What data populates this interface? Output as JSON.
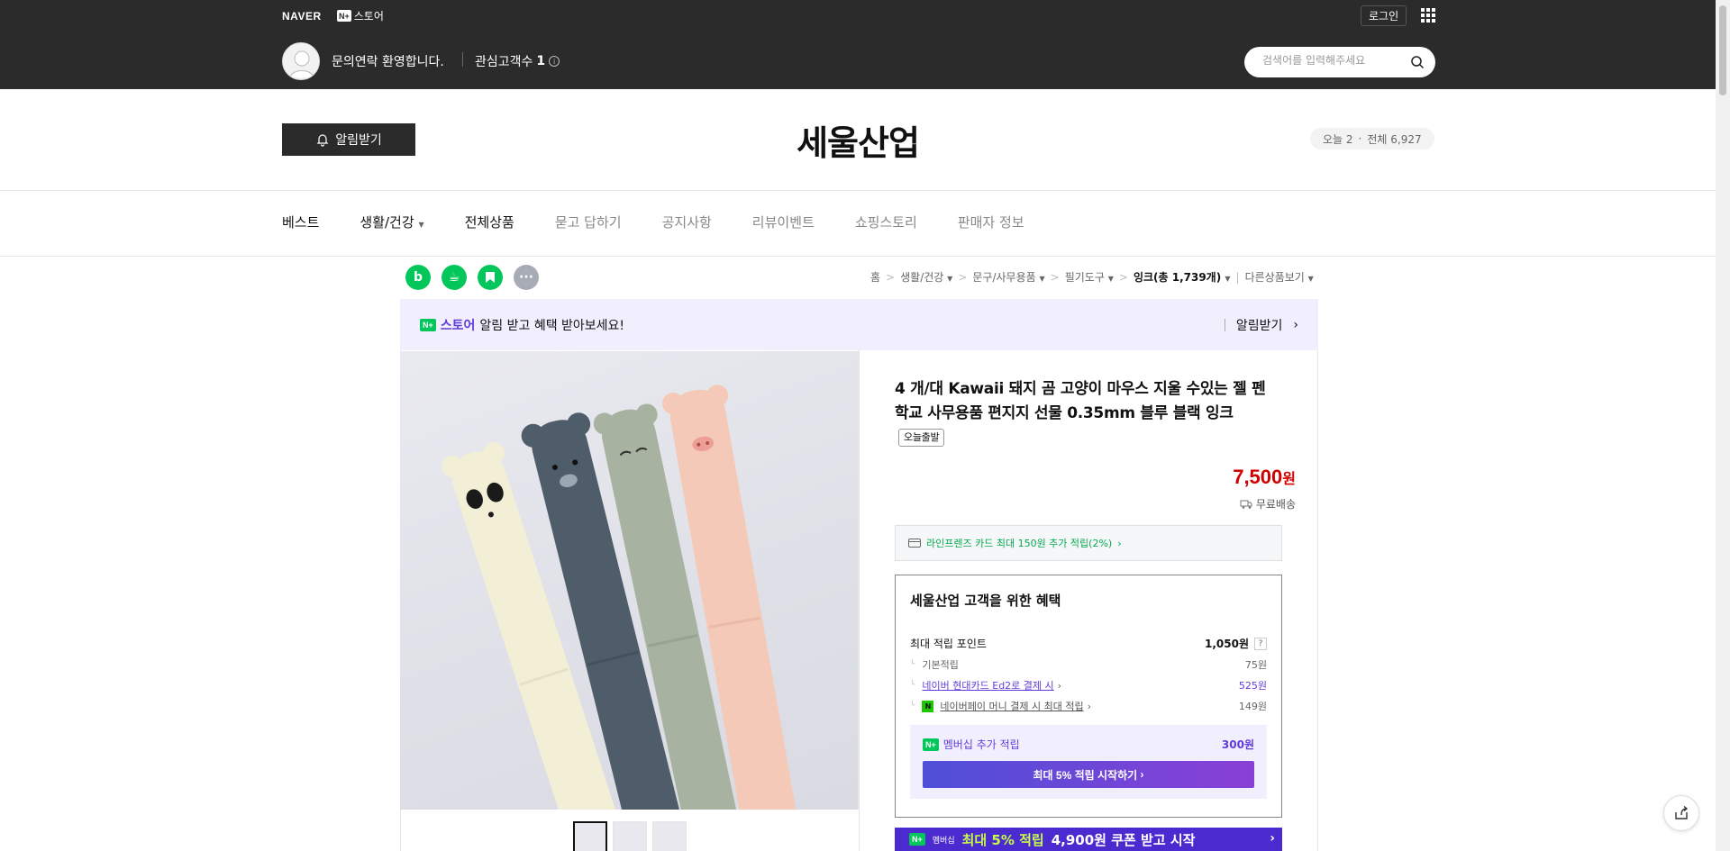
{
  "topbar": {
    "naver": "NAVER",
    "nstore_badge": "N+",
    "nstore_label": "스토어",
    "login": "로그인",
    "welcome": "문의연락 환영합니다.",
    "interest_label": "관심고객수",
    "interest_count": "1",
    "search_placeholder": "검색어를 입력해주세요"
  },
  "store": {
    "alarm_button": "알림받기",
    "title": "세울산업",
    "visitors_today": "오늘 2",
    "visitors_total": "전체 6,927"
  },
  "nav": {
    "items": [
      "베스트",
      "생활/건강",
      "전체상품",
      "묻고 답하기",
      "공지사항",
      "리뷰이벤트",
      "쇼핑스토리",
      "판매자 정보"
    ]
  },
  "breadcrumb": {
    "home": "홈",
    "c1": "생활/건강",
    "c2": "문구/사무용품",
    "c3": "필기도구",
    "current": "잉크(총 1,739개)",
    "other": "다른상품보기"
  },
  "notice": {
    "badge": "N+",
    "store_word": "스토어",
    "text": "알림 받고 혜택 받아보세요!",
    "right": "알림받기"
  },
  "product": {
    "title": "4 개/대 Kawaii 돼지 곰 고양이 마우스 지울 수있는 젤 펜 학교 사무용품 편지지 선물 0.35mm 블루 블랙 잉크",
    "tag": "오늘출발",
    "price": "7,500",
    "price_unit": "원",
    "shipping": "무료배송",
    "card_benefit": "라인프렌즈 카드 최대 150원 추가 적립(2%)"
  },
  "benefit": {
    "title": "세울산업 고객을 위한 혜택",
    "max_points_label": "최대 적립 포인트",
    "max_points_value": "1,050원",
    "q": "?",
    "rows": [
      {
        "label": "기본적립",
        "value": "75원"
      },
      {
        "label": "네이버 현대카드 Ed2로 결제 시",
        "value": "525원"
      },
      {
        "label": "네이버페이 머니 결제 시 최대 적립",
        "value": "149원"
      }
    ],
    "membership_badge": "N+",
    "membership_label": "멤버십 추가 적립",
    "membership_value": "300원",
    "membership_button": "최대 5% 적립 시작하기"
  },
  "banner": {
    "badge": "N+",
    "small": "멤버십",
    "text1": "최대 5% 적립",
    "text2": "4,900원 쿠폰 받고 시작"
  },
  "colors": {
    "topbar": "#2b2b2b",
    "naver_green": "#03c75a",
    "price_red": "#d10000",
    "purple": "#5f3bd9"
  }
}
